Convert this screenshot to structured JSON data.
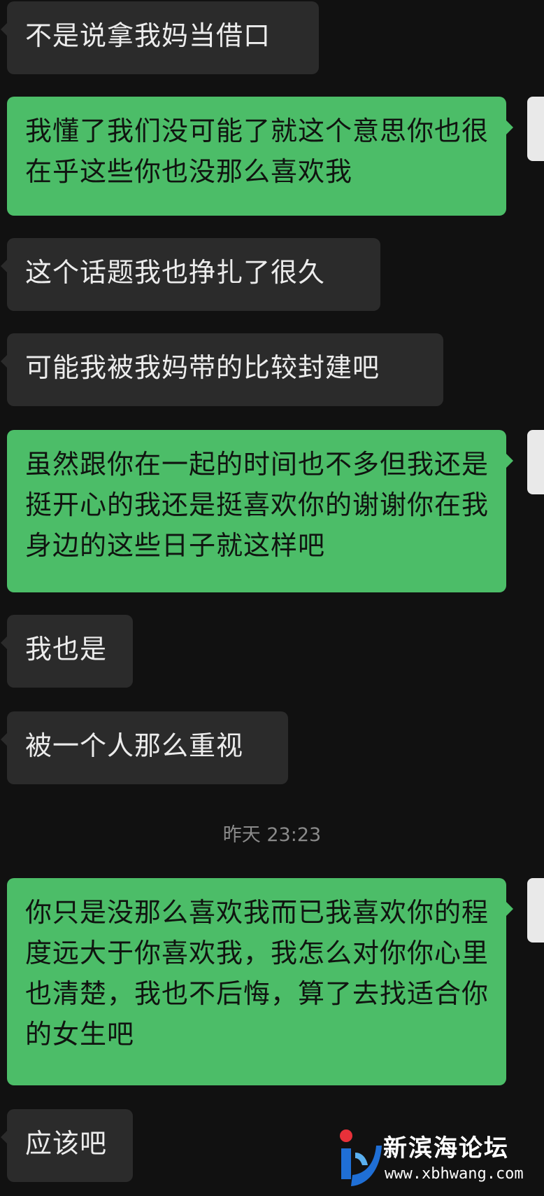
{
  "messages": [
    {
      "side": "in",
      "text": "不是说拿我妈当借口"
    },
    {
      "side": "out",
      "text": "我懂了我们没可能了就这个意思你也很在乎这些你也没那么喜欢我"
    },
    {
      "side": "in",
      "text": "这个话题我也挣扎了很久"
    },
    {
      "side": "in",
      "text": "可能我被我妈带的比较封建吧"
    },
    {
      "side": "out",
      "text": "虽然跟你在一起的时间也不多但我还是挺开心的我还是挺喜欢你的谢谢你在我身边的这些日子就这样吧"
    },
    {
      "side": "in",
      "text": "我也是"
    },
    {
      "side": "in",
      "text": "被一个人那么重视"
    },
    {
      "side": "out",
      "text": "你只是没那么喜欢我而已我喜欢你的程度远大于你喜欢我，我怎么对你你心里也清楚，我也不后悔，算了去找适合你的女生吧"
    },
    {
      "side": "in",
      "text": "应该吧"
    }
  ],
  "timestamp": "昨天 23:23",
  "watermark": {
    "name": "新滨海论坛",
    "url": "www.xbhwang.com"
  },
  "colors": {
    "background": "#111111",
    "incoming_bubble": "#2b2b2b",
    "outgoing_bubble": "#4cbd68"
  }
}
